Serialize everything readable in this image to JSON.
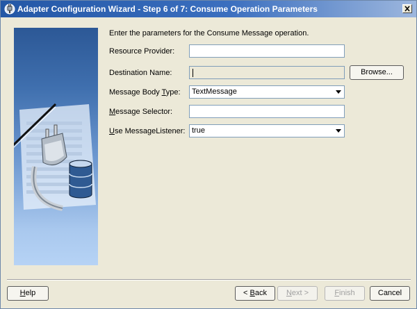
{
  "window": {
    "title": "Adapter Configuration Wizard - Step 6 of 7: Consume Operation Parameters"
  },
  "intro": "Enter the parameters for the Consume Message operation.",
  "form": {
    "resource_provider": {
      "label": "Resource Provider:",
      "value": ""
    },
    "destination_name": {
      "label": "Destination Name:",
      "value": "",
      "browse_label": "Browse..."
    },
    "message_body_type": {
      "label_pre": "Message Body ",
      "label_mnemonic": "T",
      "label_post": "ype:",
      "value": "TextMessage"
    },
    "message_selector": {
      "label_pre": "",
      "label_mnemonic": "M",
      "label_post": "essage Selector:",
      "value": ""
    },
    "use_message_listener": {
      "label_pre": "",
      "label_mnemonic": "U",
      "label_post": "se MessageListener:",
      "value": "true"
    }
  },
  "buttons": {
    "help": {
      "mnemonic": "H",
      "rest": "elp"
    },
    "back": {
      "pre": "< ",
      "mnemonic": "B",
      "rest": "ack"
    },
    "next": {
      "mnemonic": "N",
      "rest": "ext >"
    },
    "finish": {
      "mnemonic": "F",
      "rest": "inish"
    },
    "cancel": {
      "label": "Cancel"
    }
  },
  "icons": {
    "app": "wizard-plug-icon",
    "close": "close-icon"
  }
}
